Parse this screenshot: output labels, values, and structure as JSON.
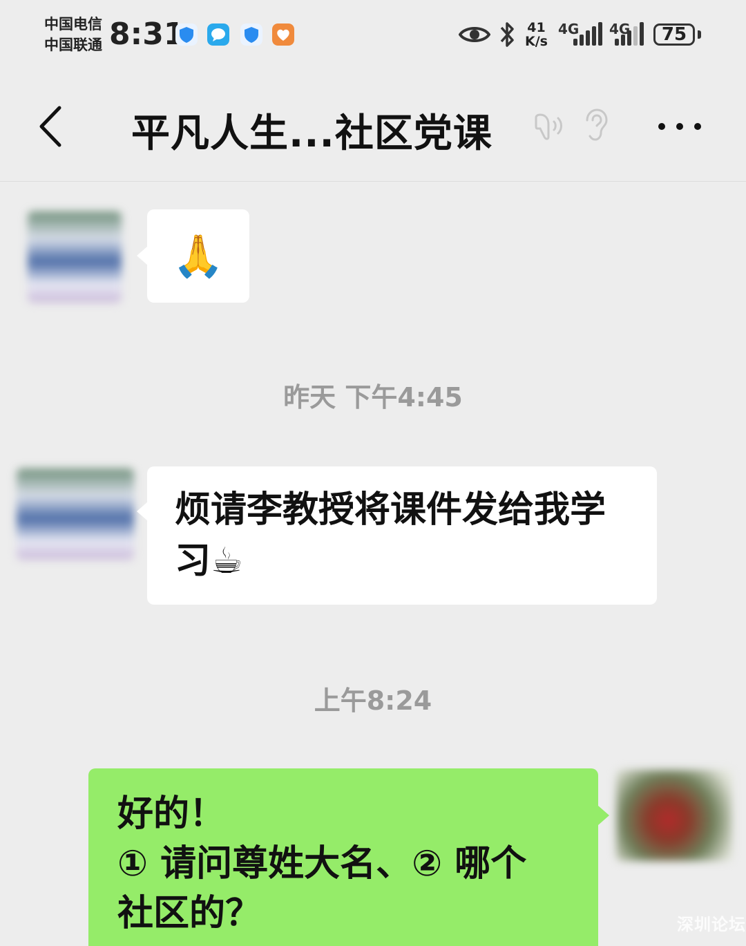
{
  "status_bar": {
    "carrier_1": "中国电信",
    "carrier_2": "中国联通",
    "time": "8:31",
    "net_speed_value": "41",
    "net_speed_unit": "K/s",
    "signal_1_label": "4G",
    "signal_2_label": "4G",
    "battery_level": "75"
  },
  "header": {
    "title": "平凡人生...社区党课"
  },
  "messages": [
    {
      "side": "left",
      "text": "🙏"
    },
    {
      "timestamp": "昨天 下午4:45"
    },
    {
      "side": "left",
      "text_line_1": "烦请李教授将课件发给我学",
      "text_line_2": "习☕"
    },
    {
      "timestamp": "上午8:24"
    },
    {
      "side": "right",
      "text_line_1": "好的！",
      "text_line_2": "① 请问尊姓大名、② 哪个",
      "text_line_3": "社区的？"
    }
  ],
  "watermark": "深圳论坛",
  "colors": {
    "background": "#ededed",
    "my_bubble": "#95ec69",
    "other_bubble": "#ffffff",
    "timestamp": "#9a9a9a"
  }
}
